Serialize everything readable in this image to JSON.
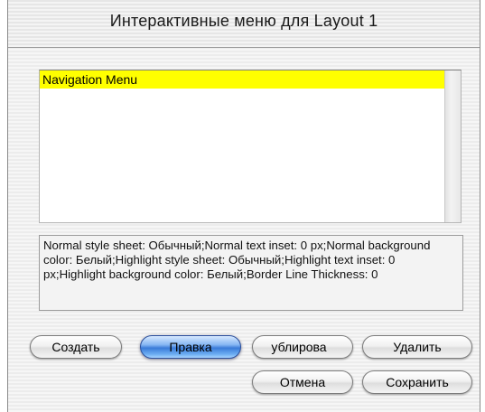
{
  "window": {
    "title": "Интерактивные меню для Layout 1"
  },
  "menu_list": {
    "items": [
      {
        "label": "Navigation Menu",
        "selected": true
      }
    ],
    "highlight_color": "#ffff00"
  },
  "description": {
    "text": "Normal style sheet: Обычный;Normal text inset: 0 px;Normal background color: Белый;Highlight style sheet: Обычный;Highlight text inset: 0 px;Highlight background color: Белый;Border Line Thickness: 0"
  },
  "buttons": {
    "create": "Создать",
    "edit": "Правка",
    "duplicate": "ублирова",
    "delete": "Удалить",
    "cancel": "Отмена",
    "save": "Сохранить"
  },
  "colors": {
    "default_button": "#3a7bd8",
    "selection": "#ffff00"
  }
}
